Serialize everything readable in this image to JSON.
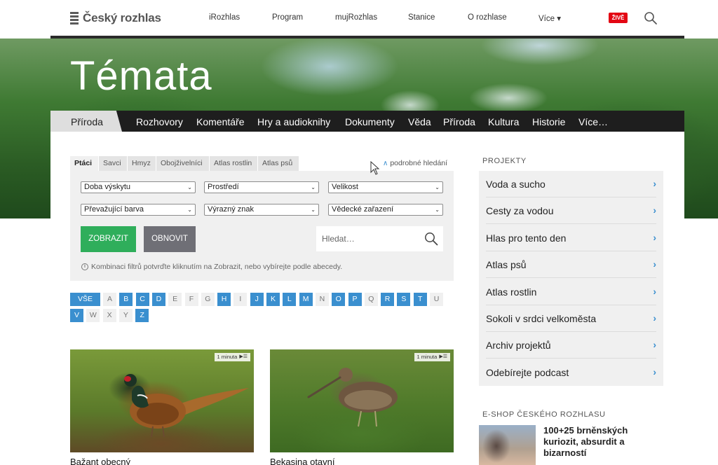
{
  "header": {
    "logo_text": "Český rozhlas",
    "nav": [
      {
        "label": "iRozhlas"
      },
      {
        "label": "Program"
      },
      {
        "label": "mujRozhlas"
      },
      {
        "label": "Stanice"
      },
      {
        "label": "O rozhlase"
      },
      {
        "label": "Více ▾"
      }
    ],
    "live_label": "ŽIVĚ",
    "icon": "search-icon"
  },
  "hero": {
    "title": "Témata"
  },
  "section_nav": {
    "active": "Příroda",
    "items": [
      "Rozhovory",
      "Komentáře",
      "Hry a audioknihy",
      "Dokumenty",
      "Věda",
      "Příroda",
      "Kultura",
      "Historie",
      "Více…"
    ]
  },
  "filters": {
    "tabs": [
      "Ptáci",
      "Savci",
      "Hmyz",
      "Obojživelníci",
      "Atlas rostlin",
      "Atlas psů"
    ],
    "active_tab": "Ptáci",
    "advanced_label": "podrobné hledání",
    "selects": [
      "Doba výskytu",
      "Prostředí",
      "Velikost",
      "Převažující barva",
      "Výrazný znak",
      "Vědecké zařazení"
    ],
    "show_button": "ZOBRAZIT",
    "reset_button": "OBNOVIT",
    "search_placeholder": "Hledat…",
    "hint": "Kombinaci filtrů potvrďte kliknutím na Zobrazit, nebo vybírejte podle abecedy."
  },
  "alphabet": {
    "all_label": "VŠE",
    "letters": [
      {
        "l": "A",
        "active": false
      },
      {
        "l": "B",
        "active": true
      },
      {
        "l": "C",
        "active": true
      },
      {
        "l": "D",
        "active": true
      },
      {
        "l": "E",
        "active": false
      },
      {
        "l": "F",
        "active": false
      },
      {
        "l": "G",
        "active": false
      },
      {
        "l": "H",
        "active": true
      },
      {
        "l": "I",
        "active": false
      },
      {
        "l": "J",
        "active": true
      },
      {
        "l": "K",
        "active": true
      },
      {
        "l": "L",
        "active": true
      },
      {
        "l": "M",
        "active": true
      },
      {
        "l": "N",
        "active": false
      },
      {
        "l": "O",
        "active": true
      },
      {
        "l": "P",
        "active": true
      },
      {
        "l": "Q",
        "active": false
      },
      {
        "l": "R",
        "active": true
      },
      {
        "l": "S",
        "active": true
      },
      {
        "l": "T",
        "active": true
      },
      {
        "l": "U",
        "active": false
      },
      {
        "l": "V",
        "active": true
      },
      {
        "l": "W",
        "active": false
      },
      {
        "l": "X",
        "active": false
      },
      {
        "l": "Y",
        "active": false
      },
      {
        "l": "Z",
        "active": true
      }
    ]
  },
  "cards": [
    {
      "title": "Bažant obecný",
      "duration": "1 minuta"
    },
    {
      "title": "Bekasina otavní",
      "duration": "1 minuta"
    }
  ],
  "sidebar": {
    "projects_heading": "PROJEKTY",
    "projects": [
      "Voda a sucho",
      "Cesty za vodou",
      "Hlas pro tento den",
      "Atlas psů",
      "Atlas rostlin",
      "Sokoli v srdci velkoměsta",
      "Archiv projektů",
      "Odebírejte podcast"
    ],
    "shop_heading": "E-SHOP ČESKÉHO ROZHLASU",
    "shop_item": "100+25 brněnských kuriozit, absurdit a bizarností"
  },
  "colors": {
    "accent_blue": "#3a8fcf",
    "show_green": "#2fae5b",
    "reset_gray": "#6f6f76",
    "live_red": "#e30613",
    "nav_dark": "#1e1e1e"
  }
}
